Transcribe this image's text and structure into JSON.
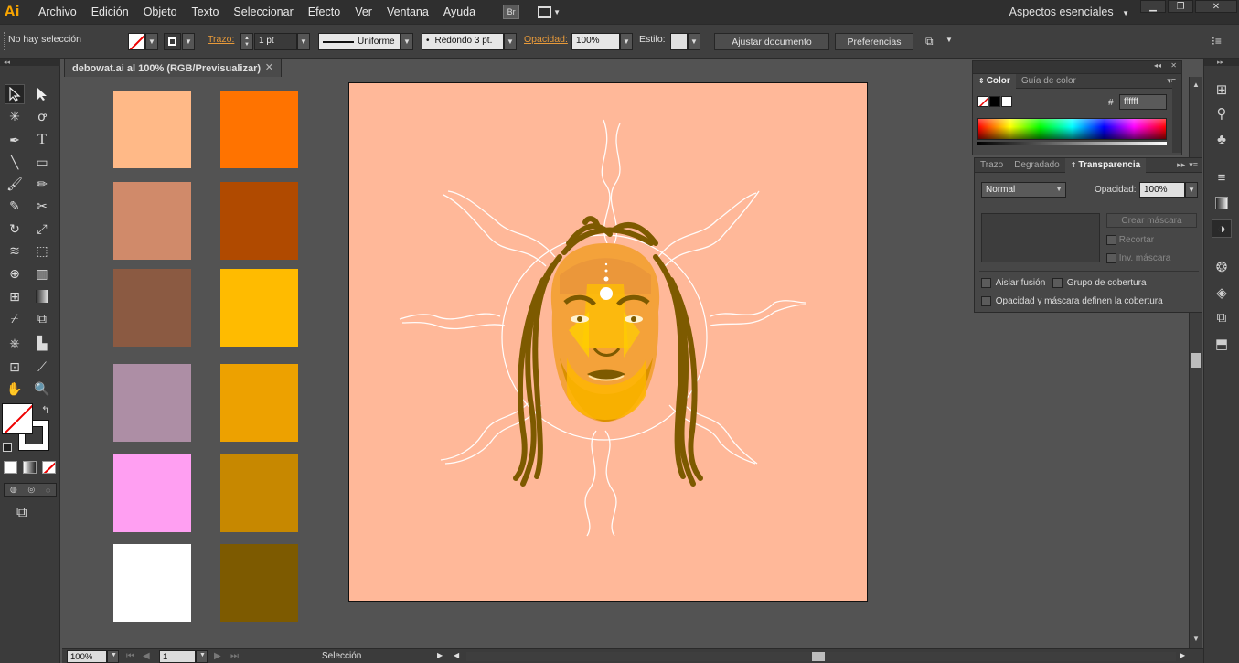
{
  "app": {
    "logo": "Ai"
  },
  "menu": [
    "Archivo",
    "Edición",
    "Objeto",
    "Texto",
    "Seleccionar",
    "Efecto",
    "Ver",
    "Ventana",
    "Ayuda"
  ],
  "menu_extra": {
    "bridge": "Br",
    "workspace": "Aspectos esenciales"
  },
  "control": {
    "selection_status": "No hay selección",
    "stroke_label": "Trazo:",
    "stroke_weight": "1 pt",
    "stroke_profile": "Uniforme",
    "brush": "Redondo 3 pt.",
    "opacity_label": "Opacidad:",
    "opacity_value": "100%",
    "style_label": "Estilo:",
    "align_doc_button": "Ajustar documento",
    "preferences_button": "Preferencias"
  },
  "document": {
    "tab_title": "debowat.ai al 100% (RGB/Previsualizar)"
  },
  "swatches": {
    "left": [
      "#ffb987",
      "#d08a6a",
      "#8b5a42",
      "#ad8ea5",
      "#ff9ff2",
      "#ffffff"
    ],
    "right": [
      "#ff7300",
      "#b04a00",
      "#ffbb00",
      "#eda100",
      "#c78800",
      "#7d5a00"
    ]
  },
  "artboard": {
    "background": "#ffb899"
  },
  "color_panel": {
    "tab_color": "Color",
    "tab_guide": "Guía de color",
    "hex_label": "#",
    "hex_value": "ffffff"
  },
  "transparency_panel": {
    "tab_stroke": "Trazo",
    "tab_gradient": "Degradado",
    "tab_transparency": "Transparencia",
    "blend_mode": "Normal",
    "opacity_label": "Opacidad:",
    "opacity_value": "100%",
    "make_mask_button": "Crear máscara",
    "clip_label": "Recortar",
    "invert_mask_label": "Inv. máscara",
    "isolate_blending_label": "Aislar fusión",
    "knockout_group_label": "Grupo de cobertura",
    "opacity_mask_label": "Opacidad y máscara definen la cobertura"
  },
  "status": {
    "zoom": "100%",
    "artboard_number": "1",
    "tool": "Selección"
  }
}
